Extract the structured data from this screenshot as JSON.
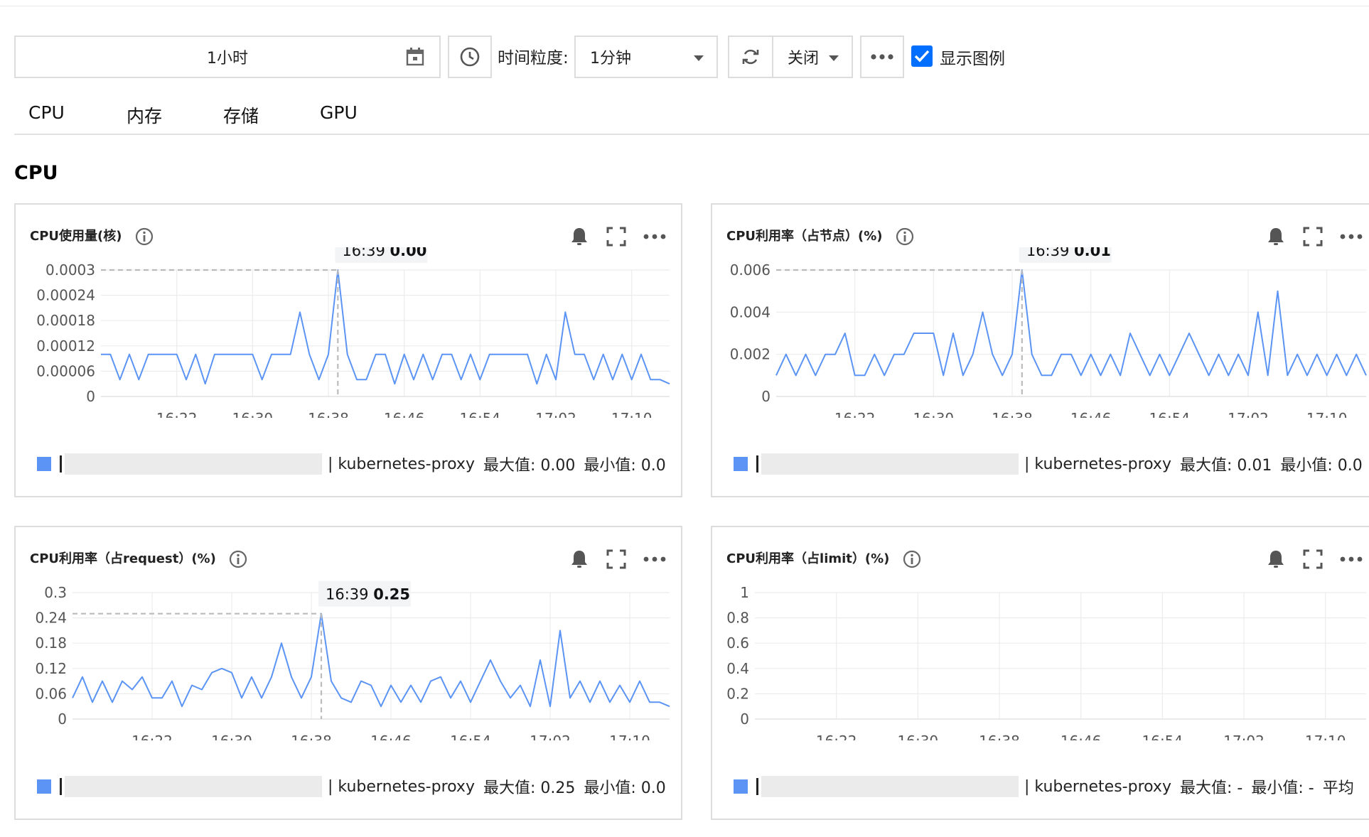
{
  "toolbar": {
    "time_range": "1小时",
    "granularity_label": "时间粒度:",
    "granularity_value": "1分钟",
    "refresh_value": "关闭",
    "show_legend_label": "显示图例",
    "show_legend_checked": true
  },
  "tabs": [
    {
      "label": "CPU"
    },
    {
      "label": "内存"
    },
    {
      "label": "存储"
    },
    {
      "label": "GPU"
    }
  ],
  "section_title": "CPU",
  "panels": [
    {
      "title": "CPU使用量(核)",
      "legend": {
        "name": "| kubernetes-proxy",
        "max": "最大值: 0.00",
        "min": "最小值: 0.0"
      },
      "tooltip": {
        "time": "16:39",
        "value": "0.00"
      }
    },
    {
      "title": "CPU利用率（占节点）(%)",
      "legend": {
        "name": "| kubernetes-proxy",
        "max": "最大值: 0.01",
        "min": "最小值: 0.0"
      },
      "tooltip": {
        "time": "16:39",
        "value": "0.01"
      }
    },
    {
      "title": "CPU利用率（占request）(%)",
      "legend": {
        "name": "| kubernetes-proxy",
        "max": "最大值: 0.25",
        "min": "最小值: 0.0"
      },
      "tooltip": {
        "time": "16:39",
        "value": "0.25"
      }
    },
    {
      "title": "CPU利用率（占limit）(%)",
      "legend": {
        "name": "| kubernetes-proxy",
        "max": "最大值: -",
        "min": "最小值: -",
        "avg": "平均"
      }
    }
  ],
  "chart_data": [
    {
      "type": "line",
      "color": "#5b94f4",
      "x_ticks": [
        "16:22",
        "16:30",
        "16:38",
        "16:46",
        "16:54",
        "17:02",
        "17:10"
      ],
      "y_ticks": [
        "0",
        "0.00006",
        "0.00012",
        "0.00018",
        "0.00024",
        "0.0003"
      ],
      "ylim": [
        0,
        0.0003
      ],
      "x_start": "16:14",
      "x_end": "17:14",
      "tooltip_x": "16:39",
      "series": [
        {
          "x": [
            "16:14",
            "16:15",
            "16:16",
            "16:17",
            "16:18",
            "16:19",
            "16:20",
            "16:21",
            "16:22",
            "16:23",
            "16:24",
            "16:25",
            "16:26",
            "16:27",
            "16:28",
            "16:29",
            "16:30",
            "16:31",
            "16:32",
            "16:33",
            "16:34",
            "16:35",
            "16:36",
            "16:37",
            "16:38",
            "16:39",
            "16:40",
            "16:41",
            "16:42",
            "16:43",
            "16:44",
            "16:45",
            "16:46",
            "16:47",
            "16:48",
            "16:49",
            "16:50",
            "16:51",
            "16:52",
            "16:53",
            "16:54",
            "16:55",
            "16:56",
            "16:57",
            "16:58",
            "16:59",
            "17:00",
            "17:01",
            "17:02",
            "17:03",
            "17:04",
            "17:05",
            "17:06",
            "17:07",
            "17:08",
            "17:09",
            "17:10",
            "17:11",
            "17:12",
            "17:13",
            "17:14"
          ],
          "values": [
            0.0001,
            0.0001,
            4e-05,
            0.0001,
            4e-05,
            0.0001,
            0.0001,
            0.0001,
            0.0001,
            4e-05,
            0.0001,
            3e-05,
            0.0001,
            0.0001,
            0.0001,
            0.0001,
            0.0001,
            4e-05,
            0.0001,
            0.0001,
            0.0001,
            0.0002,
            0.0001,
            4e-05,
            0.0001,
            0.0003,
            0.0001,
            4e-05,
            4e-05,
            0.0001,
            0.0001,
            3e-05,
            0.0001,
            4e-05,
            0.0001,
            4e-05,
            0.0001,
            0.0001,
            4e-05,
            0.0001,
            4e-05,
            0.0001,
            0.0001,
            0.0001,
            0.0001,
            0.0001,
            3e-05,
            0.0001,
            4e-05,
            0.0002,
            0.0001,
            0.0001,
            4e-05,
            0.0001,
            4e-05,
            0.0001,
            4e-05,
            0.0001,
            4e-05,
            4e-05,
            3e-05
          ]
        }
      ]
    },
    {
      "type": "line",
      "color": "#5b94f4",
      "x_ticks": [
        "16:22",
        "16:30",
        "16:38",
        "16:46",
        "16:54",
        "17:02",
        "17:10"
      ],
      "y_ticks": [
        "0",
        "0.002",
        "0.004",
        "0.006"
      ],
      "ylim": [
        0,
        0.006
      ],
      "x_start": "16:14",
      "x_end": "17:14",
      "tooltip_x": "16:39",
      "series": [
        {
          "x": [
            "16:14",
            "16:15",
            "16:16",
            "16:17",
            "16:18",
            "16:19",
            "16:20",
            "16:21",
            "16:22",
            "16:23",
            "16:24",
            "16:25",
            "16:26",
            "16:27",
            "16:28",
            "16:29",
            "16:30",
            "16:31",
            "16:32",
            "16:33",
            "16:34",
            "16:35",
            "16:36",
            "16:37",
            "16:38",
            "16:39",
            "16:40",
            "16:41",
            "16:42",
            "16:43",
            "16:44",
            "16:45",
            "16:46",
            "16:47",
            "16:48",
            "16:49",
            "16:50",
            "16:51",
            "16:52",
            "16:53",
            "16:54",
            "16:55",
            "16:56",
            "16:57",
            "16:58",
            "16:59",
            "17:00",
            "17:01",
            "17:02",
            "17:03",
            "17:04",
            "17:05",
            "17:06",
            "17:07",
            "17:08",
            "17:09",
            "17:10",
            "17:11",
            "17:12",
            "17:13",
            "17:14"
          ],
          "values": [
            0.001,
            0.002,
            0.001,
            0.002,
            0.001,
            0.002,
            0.002,
            0.003,
            0.001,
            0.001,
            0.002,
            0.001,
            0.002,
            0.002,
            0.003,
            0.003,
            0.003,
            0.001,
            0.003,
            0.001,
            0.002,
            0.004,
            0.002,
            0.001,
            0.002,
            0.006,
            0.002,
            0.001,
            0.001,
            0.002,
            0.002,
            0.001,
            0.002,
            0.001,
            0.002,
            0.001,
            0.003,
            0.002,
            0.001,
            0.002,
            0.001,
            0.002,
            0.003,
            0.002,
            0.001,
            0.002,
            0.001,
            0.002,
            0.001,
            0.004,
            0.001,
            0.005,
            0.001,
            0.002,
            0.001,
            0.002,
            0.001,
            0.002,
            0.001,
            0.002,
            0.001
          ]
        }
      ]
    },
    {
      "type": "line",
      "color": "#5b94f4",
      "x_ticks": [
        "16:22",
        "16:30",
        "16:38",
        "16:46",
        "16:54",
        "17:02",
        "17:10"
      ],
      "y_ticks": [
        "0",
        "0.06",
        "0.12",
        "0.18",
        "0.24",
        "0.3"
      ],
      "ylim": [
        0,
        0.3
      ],
      "x_start": "16:14",
      "x_end": "17:14",
      "tooltip_x": "16:39",
      "series": [
        {
          "x": [
            "16:14",
            "16:15",
            "16:16",
            "16:17",
            "16:18",
            "16:19",
            "16:20",
            "16:21",
            "16:22",
            "16:23",
            "16:24",
            "16:25",
            "16:26",
            "16:27",
            "16:28",
            "16:29",
            "16:30",
            "16:31",
            "16:32",
            "16:33",
            "16:34",
            "16:35",
            "16:36",
            "16:37",
            "16:38",
            "16:39",
            "16:40",
            "16:41",
            "16:42",
            "16:43",
            "16:44",
            "16:45",
            "16:46",
            "16:47",
            "16:48",
            "16:49",
            "16:50",
            "16:51",
            "16:52",
            "16:53",
            "16:54",
            "16:55",
            "16:56",
            "16:57",
            "16:58",
            "16:59",
            "17:00",
            "17:01",
            "17:02",
            "17:03",
            "17:04",
            "17:05",
            "17:06",
            "17:07",
            "17:08",
            "17:09",
            "17:10",
            "17:11",
            "17:12",
            "17:13",
            "17:14"
          ],
          "values": [
            0.05,
            0.1,
            0.04,
            0.09,
            0.04,
            0.09,
            0.07,
            0.1,
            0.05,
            0.05,
            0.09,
            0.03,
            0.08,
            0.07,
            0.11,
            0.12,
            0.11,
            0.05,
            0.1,
            0.05,
            0.1,
            0.18,
            0.1,
            0.05,
            0.1,
            0.25,
            0.09,
            0.05,
            0.04,
            0.09,
            0.08,
            0.03,
            0.08,
            0.04,
            0.08,
            0.04,
            0.09,
            0.1,
            0.05,
            0.09,
            0.04,
            0.09,
            0.14,
            0.09,
            0.05,
            0.08,
            0.03,
            0.14,
            0.03,
            0.21,
            0.05,
            0.09,
            0.04,
            0.09,
            0.04,
            0.08,
            0.04,
            0.09,
            0.04,
            0.04,
            0.03
          ]
        }
      ]
    },
    {
      "type": "line",
      "color": "#5b94f4",
      "x_ticks": [
        "16:22",
        "16:30",
        "16:38",
        "16:46",
        "16:54",
        "17:02",
        "17:10"
      ],
      "y_ticks": [
        "0",
        "0.2",
        "0.4",
        "0.6",
        "0.8",
        "1"
      ],
      "ylim": [
        0,
        1
      ],
      "x_start": "16:14",
      "x_end": "17:14",
      "series": []
    }
  ]
}
